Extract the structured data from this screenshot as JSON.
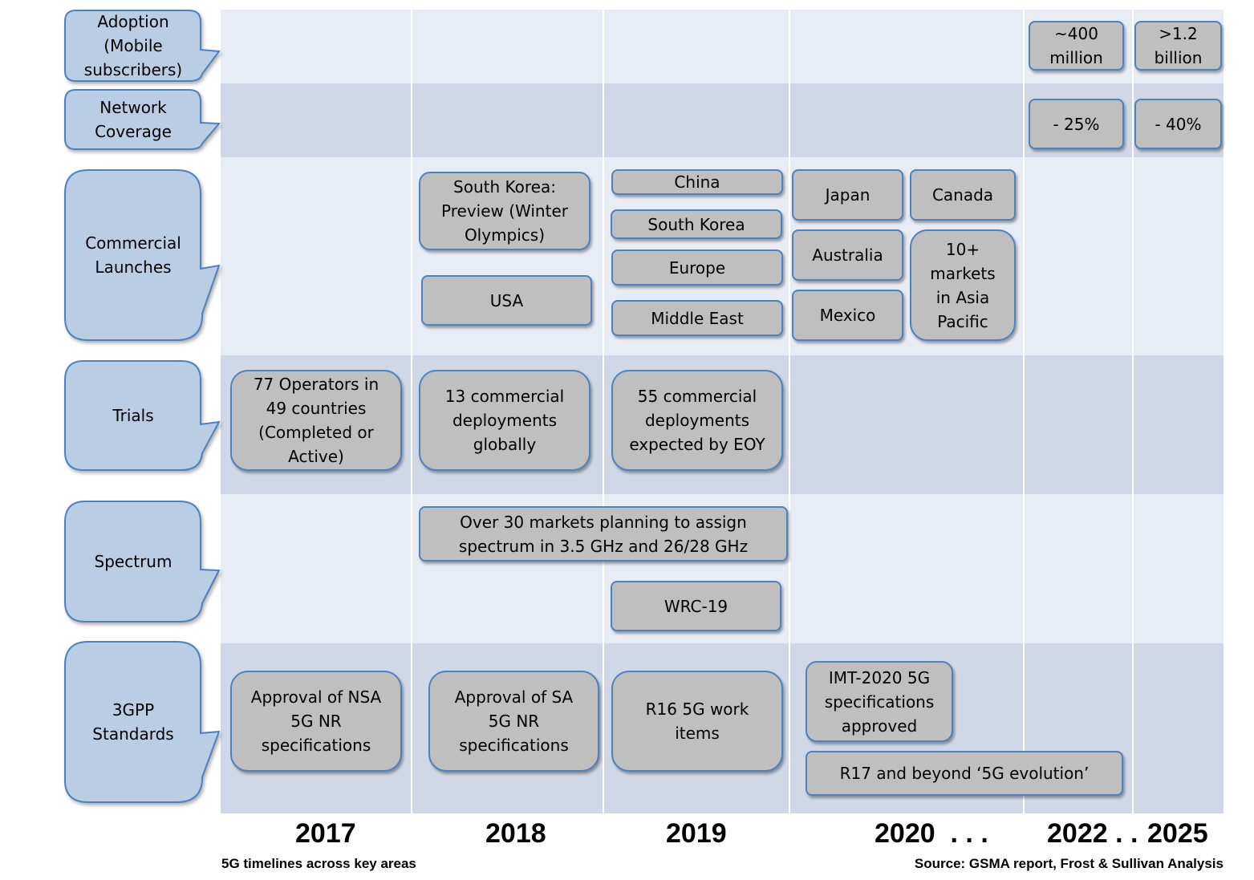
{
  "row_labels": {
    "adoption": "Adoption\n(Mobile\nsubscribers)",
    "coverage": "Network\nCoverage",
    "launches": "Commercial\nLaunches",
    "trials": "Trials",
    "spectrum": "Spectrum",
    "standards": "3GPP\nStandards"
  },
  "adoption": {
    "y2022": "~400\nmillion",
    "y2025": ">1.2\nbillion"
  },
  "coverage": {
    "y2022": "- 25%",
    "y2025": "- 40%"
  },
  "launches": {
    "y2018": [
      "South Korea:\nPreview (Winter\nOlympics)",
      "USA"
    ],
    "y2019": [
      "China",
      "South Korea",
      "Europe",
      "Middle East"
    ],
    "y2020": [
      "Japan",
      "Canada",
      "Australia",
      "Mexico",
      "10+\nmarkets\nin Asia\nPacific"
    ]
  },
  "trials": {
    "y2017": "77 Operators in\n49 countries\n(Completed or\nActive)",
    "y2018": "13 commercial\ndeployments\nglobally",
    "y2019": "55 commercial\ndeployments\nexpected by EOY"
  },
  "spectrum": {
    "markets": "Over 30 markets planning to assign\nspectrum in 3.5 GHz and 26/28 GHz",
    "wrc": "WRC-19"
  },
  "standards": {
    "y2017": "Approval of NSA\n5G NR\nspecifications",
    "y2018": "Approval of SA\n5G NR\nspecifications",
    "y2019": "R16 5G work\nitems",
    "imt": "IMT-2020 5G\nspecifications\napproved",
    "r17": "R17 and beyond ‘5G evolution’"
  },
  "timeline": {
    "years": [
      "2017",
      "2018",
      "2019",
      "2020  . . .",
      "2022 . .",
      "2025"
    ]
  },
  "captions": {
    "title": "5G timelines across key areas",
    "source": "Source: GSMA report, Frost & Sullivan Analysis"
  },
  "colors": {
    "callout_fill": "#b9cde5",
    "callout_stroke": "#4f81bd",
    "box_fill": "#bfbfbf",
    "band_light": "#e8ecf5",
    "band_dark": "#d0d8e8"
  }
}
